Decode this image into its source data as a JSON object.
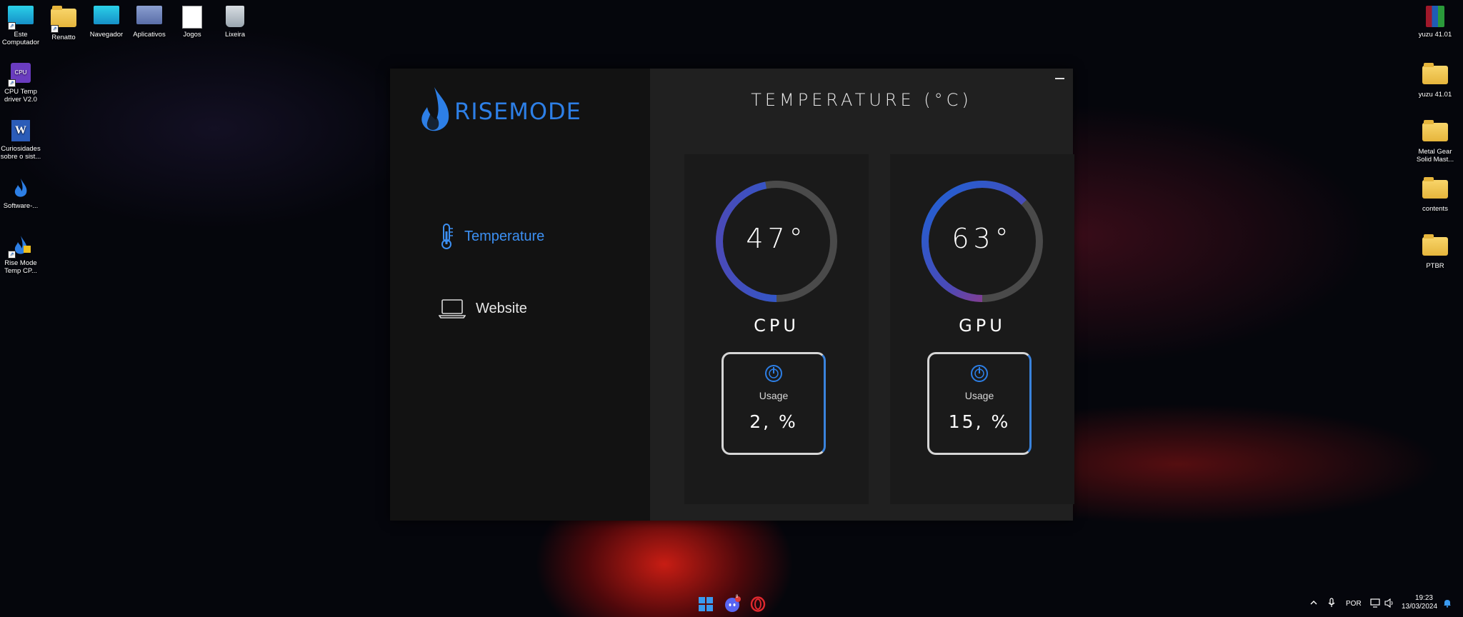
{
  "desktop": {
    "left_icons": [
      {
        "label": "Este\nComputador",
        "icon": "computer-icon"
      },
      {
        "label": "Renatto",
        "icon": "folder-icon"
      },
      {
        "label": "Navegador",
        "icon": "monitor-icon"
      },
      {
        "label": "Aplicativos",
        "icon": "apps-icon"
      },
      {
        "label": "Jogos",
        "icon": "document-icon"
      },
      {
        "label": "Lixeira",
        "icon": "recycle-bin-icon"
      },
      {
        "label": "CPU Temp\ndriver V2.0",
        "icon": "cpu-temp-icon"
      },
      {
        "label": "Curiosidades\nsobre o sist...",
        "icon": "word-doc-icon"
      },
      {
        "label": "Software-...",
        "icon": "flame-icon"
      },
      {
        "label": "Rise Mode\nTemp CP...",
        "icon": "rise-mode-icon"
      }
    ],
    "right_icons": [
      {
        "label": "yuzu 41.01",
        "icon": "winrar-icon"
      },
      {
        "label": "yuzu 41.01",
        "icon": "folder-icon"
      },
      {
        "label": "Metal Gear\nSolid Mast...",
        "icon": "folder-icon"
      },
      {
        "label": "contents",
        "icon": "folder-icon"
      },
      {
        "label": "PTBR",
        "icon": "folder-icon"
      }
    ]
  },
  "app": {
    "logo_text": "RISEMODE",
    "title": "TEMPERATURE (°C)",
    "nav": {
      "temperature": "Temperature",
      "website": "Website"
    },
    "cpu": {
      "temp": "47°",
      "temp_value": 47,
      "label": "CPU",
      "usage_label": "Usage",
      "usage": "2, %"
    },
    "gpu": {
      "temp": "63°",
      "temp_value": 63,
      "label": "GPU",
      "usage_label": "Usage",
      "usage": "15, %"
    }
  },
  "taskbar": {
    "tray_lang": "POR",
    "time": "19:23",
    "date": "13/03/2024",
    "discord_badge": "8"
  },
  "colors": {
    "accent": "#2d7fe6",
    "panel": "#1a1a1a",
    "sidebar": "#121212"
  }
}
